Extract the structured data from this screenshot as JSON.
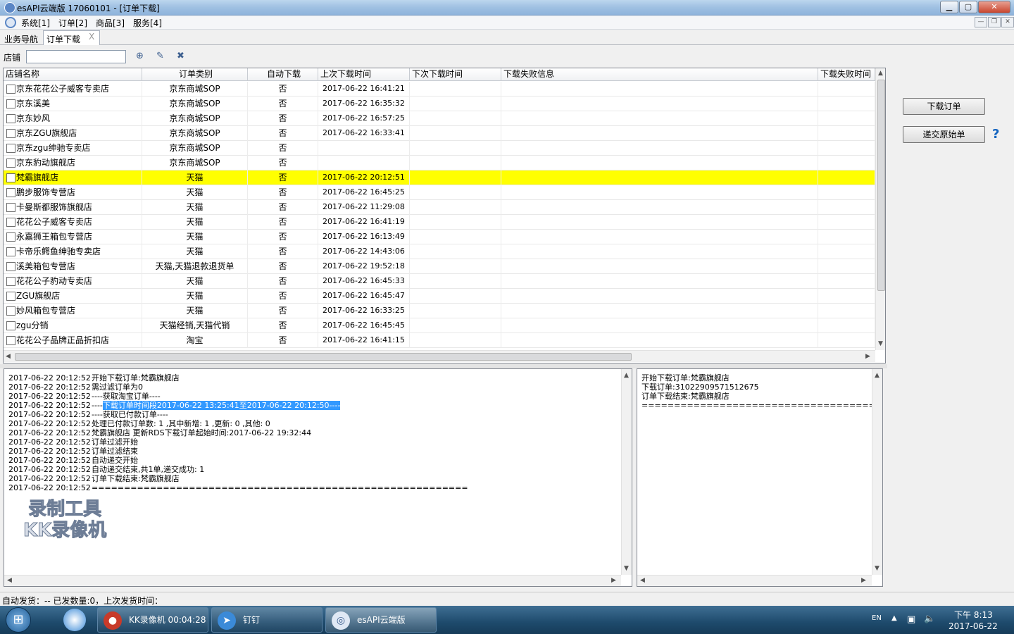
{
  "window": {
    "title": "esAPI云端版 17060101 - [订单下载]",
    "min": "▁",
    "max": "▢",
    "close": "✕"
  },
  "menu": {
    "items": [
      "系统[1]",
      "订单[2]",
      "商品[3]",
      "服务[4]"
    ],
    "mdi_min": "—",
    "mdi_restore": "❐",
    "mdi_close": "✕"
  },
  "tabs": {
    "nav": "业务导航",
    "active": "订单下载",
    "close": "X"
  },
  "filter": {
    "shop_label": "店铺",
    "shop_value": ""
  },
  "grid": {
    "headers": [
      "店铺名称",
      "订单类别",
      "自动下载",
      "上次下载时间",
      "下次下载时间",
      "下载失败信息",
      "下载失败时间"
    ],
    "rows": [
      {
        "shop": "京东花花公子威客专卖店",
        "type": "京东商城SOP",
        "auto": "否",
        "last": "2017-06-22 16:41:21"
      },
      {
        "shop": "京东溪美",
        "type": "京东商城SOP",
        "auto": "否",
        "last": "2017-06-22 16:35:32"
      },
      {
        "shop": "京东妙风",
        "type": "京东商城SOP",
        "auto": "否",
        "last": "2017-06-22 16:57:25"
      },
      {
        "shop": "京东ZGU旗舰店",
        "type": "京东商城SOP",
        "auto": "否",
        "last": "2017-06-22 16:33:41"
      },
      {
        "shop": "京东zgu绅驰专卖店",
        "type": "京东商城SOP",
        "auto": "否",
        "last": ""
      },
      {
        "shop": "京东豹动旗舰店",
        "type": "京东商城SOP",
        "auto": "否",
        "last": ""
      },
      {
        "shop": "梵霸旗舰店",
        "type": "天猫",
        "auto": "否",
        "last": "2017-06-22 20:12:51",
        "selected": true
      },
      {
        "shop": "鹏步服饰专营店",
        "type": "天猫",
        "auto": "否",
        "last": "2017-06-22 16:45:25"
      },
      {
        "shop": "卡曼斯都服饰旗舰店",
        "type": "天猫",
        "auto": "否",
        "last": "2017-06-22 11:29:08"
      },
      {
        "shop": "花花公子威客专卖店",
        "type": "天猫",
        "auto": "否",
        "last": "2017-06-22 16:41:19"
      },
      {
        "shop": "永嘉狮王箱包专营店",
        "type": "天猫",
        "auto": "否",
        "last": "2017-06-22 16:13:49"
      },
      {
        "shop": "卡帝乐鳄鱼绅驰专卖店",
        "type": "天猫",
        "auto": "否",
        "last": "2017-06-22 14:43:06"
      },
      {
        "shop": "溪美箱包专营店",
        "type": "天猫,天猫退款退货单",
        "auto": "否",
        "last": "2017-06-22 19:52:18"
      },
      {
        "shop": "花花公子豹动专卖店",
        "type": "天猫",
        "auto": "否",
        "last": "2017-06-22 16:45:33"
      },
      {
        "shop": "ZGU旗舰店",
        "type": "天猫",
        "auto": "否",
        "last": "2017-06-22 16:45:47"
      },
      {
        "shop": "妙风箱包专营店",
        "type": "天猫",
        "auto": "否",
        "last": "2017-06-22 16:33:25"
      },
      {
        "shop": "zgu分销",
        "type": "天猫经销,天猫代销",
        "auto": "否",
        "last": "2017-06-22 16:45:45"
      },
      {
        "shop": "花花公子品牌正品折扣店",
        "type": "淘宝",
        "auto": "否",
        "last": "2017-06-22 16:41:15"
      }
    ]
  },
  "buttons": {
    "download": "下载订单",
    "submit": "递交原始单",
    "help": "?"
  },
  "log": {
    "lines": [
      {
        "t": "2017-06-22 20:12:52",
        "m": "开始下载订单:梵霸旗舰店"
      },
      {
        "t": "2017-06-22 20:12:52",
        "m": "需过滤订单为0"
      },
      {
        "t": "2017-06-22 20:12:52",
        "m": "----获取淘宝订单----"
      },
      {
        "t": "2017-06-22 20:12:52",
        "m": "----",
        "hl": "下载订单时间段2017-06-22 13:25:41至2017-06-22 20:12:50----"
      },
      {
        "t": "2017-06-22 20:12:52",
        "m": "----获取已付款订单----"
      },
      {
        "t": "2017-06-22 20:12:52",
        "m": "处理已付款订单数: 1 ,其中新增: 1 ,更新: 0 ,其他: 0"
      },
      {
        "t": "2017-06-22 20:12:52",
        "m": "梵霸旗舰店 更新RDS下载订单起始时间:2017-06-22 19:32:44"
      },
      {
        "t": "2017-06-22 20:12:52",
        "m": "订单过滤开始"
      },
      {
        "t": "2017-06-22 20:12:52",
        "m": "订单过滤结束"
      },
      {
        "t": "2017-06-22 20:12:52",
        "m": "自动递交开始"
      },
      {
        "t": "2017-06-22 20:12:52",
        "m": "自动递交结束,共1单,递交成功: 1"
      },
      {
        "t": "2017-06-22 20:12:52",
        "m": "订单下载结束:梵霸旗舰店"
      },
      {
        "t": "2017-06-22 20:12:52",
        "m": "=========================================================="
      }
    ]
  },
  "rlog": {
    "lines": [
      "开始下载订单:梵霸旗舰店",
      "下载订单:310229095715126​75",
      "订单下载结束:梵霸旗舰店",
      "======================================="
    ]
  },
  "watermark": {
    "line1": "录制工具",
    "line2": "KK录像机"
  },
  "status": {
    "text": "自动发货：-- 已发数量:0，上次发货时间："
  },
  "taskbar": {
    "items": [
      {
        "label": "KK录像机 00:04:28",
        "icon": "kk-recorder-icon"
      },
      {
        "label": "钉钉",
        "icon": "dingtalk-icon"
      },
      {
        "label": "esAPI云端版",
        "icon": "esapi-icon"
      }
    ],
    "lang": "EN",
    "time": "下午 8:13",
    "date": "2017-06-22"
  },
  "colors": {
    "selected_row": "#ffff00",
    "highlight": "#3399ff",
    "taskbar": "#1e4a6c"
  }
}
